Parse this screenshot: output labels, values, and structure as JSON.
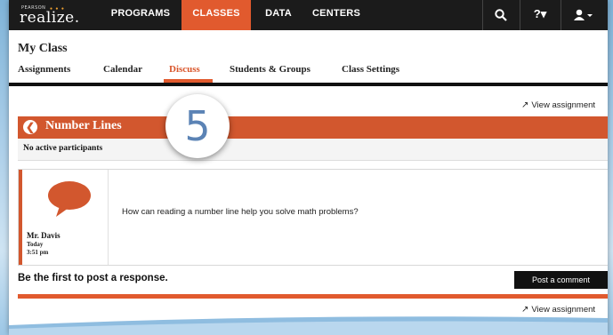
{
  "nav": {
    "logo_top": "PEARSON",
    "logo": "realize.",
    "items": [
      {
        "label": "PROGRAMS",
        "active": false
      },
      {
        "label": "CLASSES",
        "active": true
      },
      {
        "label": "DATA",
        "active": false
      },
      {
        "label": "CENTERS",
        "active": false
      }
    ],
    "help_label": "?▾",
    "accent_color": "#e15a2e"
  },
  "class_title": "My Class",
  "tabs": [
    {
      "label": "Assignments",
      "active": false
    },
    {
      "label": "Calendar",
      "active": false
    },
    {
      "label": "Discuss",
      "active": true
    },
    {
      "label": "Students & Groups",
      "active": false
    },
    {
      "label": "Class Settings",
      "active": false
    }
  ],
  "view_assignment": "View assignment",
  "discussion": {
    "title": "Number Lines",
    "participants": "No active participants",
    "post": {
      "author": "Mr. Davis",
      "date": "Today",
      "time": "3:51 pm",
      "text": "How can reading a number line help you solve math problems?"
    },
    "prompt": "Be the first to post a response.",
    "button": "Post a comment"
  },
  "step_number": "5"
}
